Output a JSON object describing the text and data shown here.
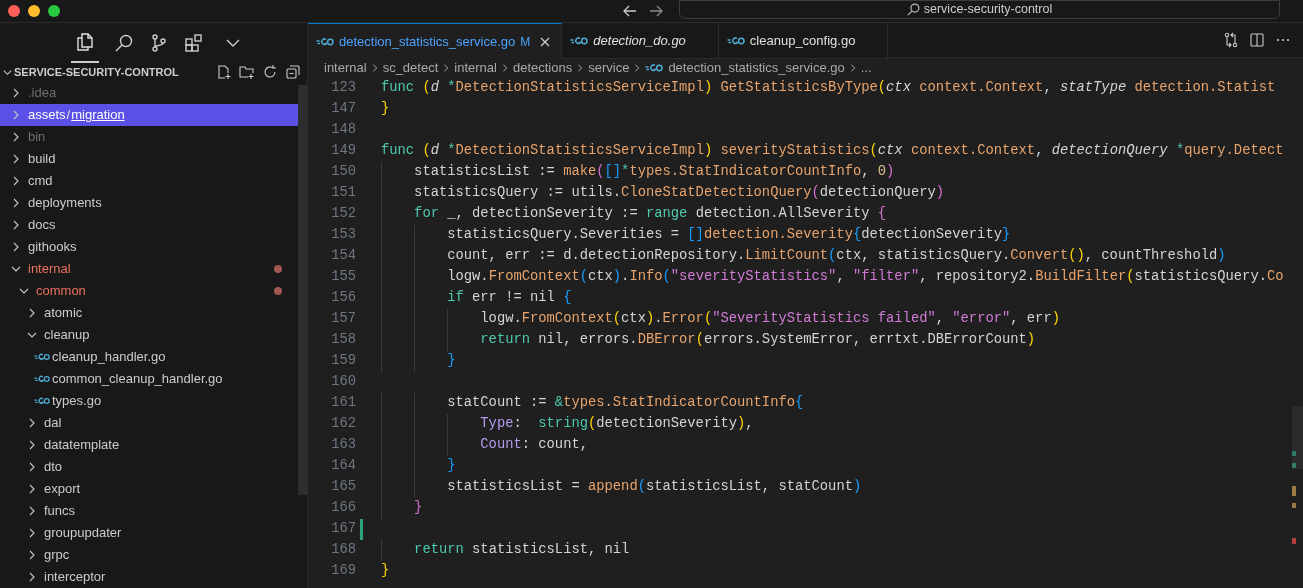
{
  "title_bar": {
    "search_text": "service-security-control"
  },
  "sidebar": {
    "header": "SERVICE-SECURITY-CONTROL",
    "tree": [
      {
        "kind": "folder",
        "label_parts": [
          ".idea"
        ],
        "expanded": false,
        "ignored": true,
        "modified": false,
        "selected": false
      },
      {
        "kind": "folder",
        "label_parts": [
          "assets",
          "/",
          "migration"
        ],
        "expanded": false,
        "ignored": false,
        "modified": false,
        "selected": true
      },
      {
        "kind": "folder",
        "label_parts": [
          "bin"
        ],
        "expanded": false,
        "ignored": true,
        "modified": false,
        "selected": false
      },
      {
        "kind": "folder",
        "label_parts": [
          "build"
        ],
        "expanded": false,
        "ignored": false,
        "modified": false,
        "selected": false
      },
      {
        "kind": "folder",
        "label_parts": [
          "cmd"
        ],
        "expanded": false,
        "ignored": false,
        "modified": false,
        "selected": false
      },
      {
        "kind": "folder",
        "label_parts": [
          "deployments"
        ],
        "expanded": false,
        "ignored": false,
        "modified": false,
        "selected": false
      },
      {
        "kind": "folder",
        "label_parts": [
          "docs"
        ],
        "expanded": false,
        "ignored": false,
        "modified": false,
        "selected": false
      },
      {
        "kind": "folder",
        "label_parts": [
          "githooks"
        ],
        "expanded": false,
        "ignored": false,
        "modified": false,
        "selected": false
      },
      {
        "kind": "folder",
        "label_parts": [
          "internal"
        ],
        "expanded": true,
        "ignored": false,
        "modified": true,
        "selected": false,
        "children": [
          {
            "kind": "folder",
            "label_parts": [
              "common"
            ],
            "expanded": true,
            "ignored": false,
            "modified": true,
            "selected": false,
            "children": [
              {
                "kind": "folder",
                "label_parts": [
                  "atomic"
                ],
                "expanded": false,
                "ignored": false,
                "modified": false,
                "selected": false
              },
              {
                "kind": "folder",
                "label_parts": [
                  "cleanup"
                ],
                "expanded": true,
                "ignored": false,
                "modified": false,
                "selected": false,
                "children": [
                  {
                    "kind": "file",
                    "label_parts": [
                      "cleanup_handler.go"
                    ],
                    "ignored": false,
                    "modified": false,
                    "selected": false
                  },
                  {
                    "kind": "file",
                    "label_parts": [
                      "common_cleanup_handler.go"
                    ],
                    "ignored": false,
                    "modified": false,
                    "selected": false
                  },
                  {
                    "kind": "file",
                    "label_parts": [
                      "types.go"
                    ],
                    "ignored": false,
                    "modified": false,
                    "selected": false
                  }
                ]
              },
              {
                "kind": "folder",
                "label_parts": [
                  "dal"
                ],
                "expanded": false,
                "ignored": false,
                "modified": false,
                "selected": false
              },
              {
                "kind": "folder",
                "label_parts": [
                  "datatemplate"
                ],
                "expanded": false,
                "ignored": false,
                "modified": false,
                "selected": false
              },
              {
                "kind": "folder",
                "label_parts": [
                  "dto"
                ],
                "expanded": false,
                "ignored": false,
                "modified": false,
                "selected": false
              },
              {
                "kind": "folder",
                "label_parts": [
                  "export"
                ],
                "expanded": false,
                "ignored": false,
                "modified": false,
                "selected": false
              },
              {
                "kind": "folder",
                "label_parts": [
                  "funcs"
                ],
                "expanded": false,
                "ignored": false,
                "modified": false,
                "selected": false
              },
              {
                "kind": "folder",
                "label_parts": [
                  "groupupdater"
                ],
                "expanded": false,
                "ignored": false,
                "modified": false,
                "selected": false
              },
              {
                "kind": "folder",
                "label_parts": [
                  "grpc"
                ],
                "expanded": false,
                "ignored": false,
                "modified": false,
                "selected": false
              },
              {
                "kind": "folder",
                "label_parts": [
                  "interceptor"
                ],
                "expanded": false,
                "ignored": false,
                "modified": false,
                "selected": false
              }
            ]
          }
        ]
      }
    ]
  },
  "tabs": [
    {
      "label": "detection_statistics_service.go",
      "badge": "M",
      "selected": true,
      "preview": false
    },
    {
      "label": "detection_do.go",
      "selected": false,
      "preview": true
    },
    {
      "label": "cleanup_config.go",
      "selected": false,
      "preview": false
    }
  ],
  "breadcrumbs": [
    {
      "kind": "folder",
      "text": "internal"
    },
    {
      "kind": "folder",
      "text": "sc_detect"
    },
    {
      "kind": "folder",
      "text": "internal"
    },
    {
      "kind": "folder",
      "text": "detections"
    },
    {
      "kind": "folder",
      "text": "service"
    },
    {
      "kind": "file",
      "text": "detection_statistics_service.go"
    },
    {
      "kind": "more",
      "text": "..."
    }
  ],
  "code_lines": [
    {
      "number": "123",
      "added": false,
      "tokens": [
        {
          "kind": "kw",
          "text": "func "
        },
        {
          "kind": "b1",
          "text": "("
        },
        {
          "kind": "param",
          "text": "d "
        },
        {
          "kind": "op",
          "text": "*"
        },
        {
          "kind": "fn",
          "text": "DetectionStatisticsServiceImpl"
        },
        {
          "kind": "b1",
          "text": ") "
        },
        {
          "kind": "fn",
          "text": "GetStatisticsByType"
        },
        {
          "kind": "b1",
          "text": "("
        },
        {
          "kind": "param",
          "text": "ctx "
        },
        {
          "kind": "fn",
          "text": "context.Context"
        },
        {
          "kind": "id",
          "text": ", "
        },
        {
          "kind": "param",
          "text": "statType "
        },
        {
          "kind": "fn",
          "text": "detection.Statist"
        }
      ]
    },
    {
      "number": "147",
      "added": false,
      "tokens": [
        {
          "kind": "b1",
          "text": "}"
        }
      ]
    },
    {
      "number": "148",
      "added": false
    },
    {
      "number": "149",
      "added": false,
      "tokens": [
        {
          "kind": "kw",
          "text": "func "
        },
        {
          "kind": "b1",
          "text": "("
        },
        {
          "kind": "param",
          "text": "d "
        },
        {
          "kind": "op",
          "text": "*"
        },
        {
          "kind": "fn",
          "text": "DetectionStatisticsServiceImpl"
        },
        {
          "kind": "b1",
          "text": ") "
        },
        {
          "kind": "fn",
          "text": "severityStatistics"
        },
        {
          "kind": "b1",
          "text": "("
        },
        {
          "kind": "param",
          "text": "ctx "
        },
        {
          "kind": "fn",
          "text": "context.Context"
        },
        {
          "kind": "id",
          "text": ", "
        },
        {
          "kind": "param",
          "text": "detectionQuery "
        },
        {
          "kind": "op",
          "text": "*"
        },
        {
          "kind": "fn",
          "text": "query.Detect"
        }
      ]
    },
    {
      "number": "150",
      "added": false,
      "tokens": [
        {
          "kind": "id",
          "text": "    statisticsList := "
        },
        {
          "kind": "fn",
          "text": "make"
        },
        {
          "kind": "b2",
          "text": "("
        },
        {
          "kind": "b3",
          "text": "[]"
        },
        {
          "kind": "op",
          "text": "*"
        },
        {
          "kind": "fn",
          "text": "types.StatIndicatorCountInfo"
        },
        {
          "kind": "id",
          "text": ", "
        },
        {
          "kind": "num",
          "text": "0"
        },
        {
          "kind": "b2",
          "text": ")"
        }
      ]
    },
    {
      "number": "151",
      "added": false,
      "tokens": [
        {
          "kind": "id",
          "text": "    statisticsQuery := utils."
        },
        {
          "kind": "fn",
          "text": "CloneStatDetectionQuery"
        },
        {
          "kind": "b2",
          "text": "("
        },
        {
          "kind": "id",
          "text": "detectionQuery"
        },
        {
          "kind": "b2",
          "text": ")"
        }
      ]
    },
    {
      "number": "152",
      "added": false,
      "tokens": [
        {
          "kind": "kw",
          "text": "    for"
        },
        {
          "kind": "id",
          "text": " _, detectionSeverity := "
        },
        {
          "kind": "kw",
          "text": "range"
        },
        {
          "kind": "id",
          "text": " detection.AllSeverity "
        },
        {
          "kind": "b2",
          "text": "{"
        }
      ]
    },
    {
      "number": "153",
      "added": false,
      "tokens": [
        {
          "kind": "id",
          "text": "        statisticsQuery.Severities = "
        },
        {
          "kind": "b3",
          "text": "[]"
        },
        {
          "kind": "fn",
          "text": "detection.Severity"
        },
        {
          "kind": "b3",
          "text": "{"
        },
        {
          "kind": "id",
          "text": "detectionSeverity"
        },
        {
          "kind": "b3",
          "text": "}"
        }
      ]
    },
    {
      "number": "154",
      "added": false,
      "tokens": [
        {
          "kind": "id",
          "text": "        count, err := d.detectionRepository."
        },
        {
          "kind": "fn",
          "text": "LimitCount"
        },
        {
          "kind": "b3",
          "text": "("
        },
        {
          "kind": "id",
          "text": "ctx, statisticsQuery."
        },
        {
          "kind": "fn",
          "text": "Convert"
        },
        {
          "kind": "b1",
          "text": "()"
        },
        {
          "kind": "id",
          "text": ", countThreshold"
        },
        {
          "kind": "b3",
          "text": ")"
        }
      ]
    },
    {
      "number": "155",
      "added": false,
      "tokens": [
        {
          "kind": "id",
          "text": "        logw."
        },
        {
          "kind": "fn",
          "text": "FromContext"
        },
        {
          "kind": "b3",
          "text": "("
        },
        {
          "kind": "id",
          "text": "ctx"
        },
        {
          "kind": "b3",
          "text": ")"
        },
        {
          "kind": "id",
          "text": "."
        },
        {
          "kind": "fn",
          "text": "Info"
        },
        {
          "kind": "b3",
          "text": "("
        },
        {
          "kind": "str",
          "text": "\"severityStatistics\""
        },
        {
          "kind": "id",
          "text": ", "
        },
        {
          "kind": "str",
          "text": "\"filter\""
        },
        {
          "kind": "id",
          "text": ", repository2."
        },
        {
          "kind": "fn",
          "text": "BuildFilter"
        },
        {
          "kind": "b1",
          "text": "("
        },
        {
          "kind": "id",
          "text": "statisticsQuery."
        },
        {
          "kind": "fn",
          "text": "Co"
        }
      ]
    },
    {
      "number": "156",
      "added": false,
      "tokens": [
        {
          "kind": "kw",
          "text": "        if"
        },
        {
          "kind": "id",
          "text": " err != nil "
        },
        {
          "kind": "b3",
          "text": "{"
        }
      ]
    },
    {
      "number": "157",
      "added": false,
      "tokens": [
        {
          "kind": "id",
          "text": "            logw."
        },
        {
          "kind": "fn",
          "text": "FromContext"
        },
        {
          "kind": "b1",
          "text": "("
        },
        {
          "kind": "id",
          "text": "ctx"
        },
        {
          "kind": "b1",
          "text": ")"
        },
        {
          "kind": "id",
          "text": "."
        },
        {
          "kind": "fn",
          "text": "Error"
        },
        {
          "kind": "b1",
          "text": "("
        },
        {
          "kind": "str",
          "text": "\"SeverityStatistics failed\""
        },
        {
          "kind": "id",
          "text": ", "
        },
        {
          "kind": "str",
          "text": "\"error\""
        },
        {
          "kind": "id",
          "text": ", err"
        },
        {
          "kind": "b1",
          "text": ")"
        }
      ]
    },
    {
      "number": "158",
      "added": false,
      "tokens": [
        {
          "kind": "kw",
          "text": "            return"
        },
        {
          "kind": "id",
          "text": " nil, errors."
        },
        {
          "kind": "fn",
          "text": "DBError"
        },
        {
          "kind": "b1",
          "text": "("
        },
        {
          "kind": "id",
          "text": "errors.SystemError, errtxt.DBErrorCount"
        },
        {
          "kind": "b1",
          "text": ")"
        }
      ]
    },
    {
      "number": "159",
      "added": false,
      "tokens": [
        {
          "kind": "b3",
          "text": "        }"
        }
      ]
    },
    {
      "number": "160",
      "added": false
    },
    {
      "number": "161",
      "added": false,
      "tokens": [
        {
          "kind": "id",
          "text": "        statCount := "
        },
        {
          "kind": "op",
          "text": "&"
        },
        {
          "kind": "fn",
          "text": "types.StatIndicatorCountInfo"
        },
        {
          "kind": "b3",
          "text": "{"
        }
      ]
    },
    {
      "number": "162",
      "added": false,
      "tokens": [
        {
          "kind": "field",
          "text": "            Type"
        },
        {
          "kind": "id",
          "text": ":  "
        },
        {
          "kind": "kw",
          "text": "string"
        },
        {
          "kind": "b1",
          "text": "("
        },
        {
          "kind": "id",
          "text": "detectionSeverity"
        },
        {
          "kind": "b1",
          "text": ")"
        },
        {
          "kind": "id",
          "text": ","
        }
      ]
    },
    {
      "number": "163",
      "added": false,
      "tokens": [
        {
          "kind": "field",
          "text": "            Count"
        },
        {
          "kind": "id",
          "text": ": count,"
        }
      ]
    },
    {
      "number": "164",
      "added": false,
      "tokens": [
        {
          "kind": "b3",
          "text": "        }"
        }
      ]
    },
    {
      "number": "165",
      "added": false,
      "tokens": [
        {
          "kind": "id",
          "text": "        statisticsList = "
        },
        {
          "kind": "fn",
          "text": "append"
        },
        {
          "kind": "b3",
          "text": "("
        },
        {
          "kind": "id",
          "text": "statisticsList, statCount"
        },
        {
          "kind": "b3",
          "text": ")"
        }
      ]
    },
    {
      "number": "166",
      "added": false,
      "tokens": [
        {
          "kind": "b2",
          "text": "    }"
        }
      ]
    },
    {
      "number": "167",
      "added": true
    },
    {
      "number": "168",
      "added": false,
      "tokens": [
        {
          "kind": "kw",
          "text": "    return"
        },
        {
          "kind": "id",
          "text": " statisticsList, nil"
        }
      ]
    },
    {
      "number": "169",
      "added": false,
      "tokens": [
        {
          "kind": "b1",
          "text": "}"
        }
      ]
    }
  ]
}
